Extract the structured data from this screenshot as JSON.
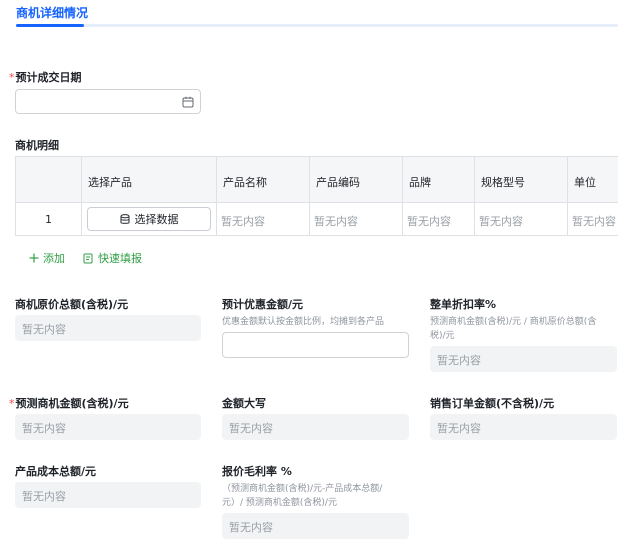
{
  "tabs": {
    "active": "商机详细情况"
  },
  "expected_date": {
    "label": "预计成交日期",
    "required_mark": "*",
    "value": "",
    "icon": "calendar-icon"
  },
  "details": {
    "title": "商机明细",
    "columns": [
      "选择产品",
      "产品名称",
      "产品编码",
      "品牌",
      "规格型号",
      "单位"
    ],
    "row": {
      "index": "1",
      "select_button": "选择数据",
      "select_icon": "database-icon",
      "empty": [
        "暂无内容",
        "暂无内容",
        "暂无内容",
        "暂无内容",
        "暂无内容"
      ]
    },
    "actions": {
      "add": "添加",
      "quick_fill": "快速填报"
    }
  },
  "fields": {
    "original_total": {
      "label": "商机原价总额(含税)/元",
      "value": "暂无内容"
    },
    "discount_amount": {
      "label": "预计优惠金额/元",
      "hint": "优惠金额默认按金额比例，均摊到各产品",
      "value": ""
    },
    "discount_rate": {
      "label": "整单折扣率%",
      "hint_line1": "预测商机金额(含税)/元 / 商机原价总额(含",
      "hint_line2": "税)/元",
      "value": "暂无内容"
    },
    "forecast_amount": {
      "label": "预测商机金额(含税)/元",
      "required_mark": "*",
      "value": "暂无内容"
    },
    "amount_uppercase": {
      "label": "金额大写",
      "value": "暂无内容"
    },
    "order_amount": {
      "label": "销售订单金额(不含税)/元",
      "value": "暂无内容"
    },
    "cost_total": {
      "label": "产品成本总额/元",
      "value": "暂无内容"
    },
    "gross_margin": {
      "label": "报价毛利率 %",
      "hint_line1": "（预测商机金额(含税)/元-产品成本总额/",
      "hint_line2": "元）/ 预测商机金额(含税)/元",
      "value": "暂无内容"
    }
  }
}
